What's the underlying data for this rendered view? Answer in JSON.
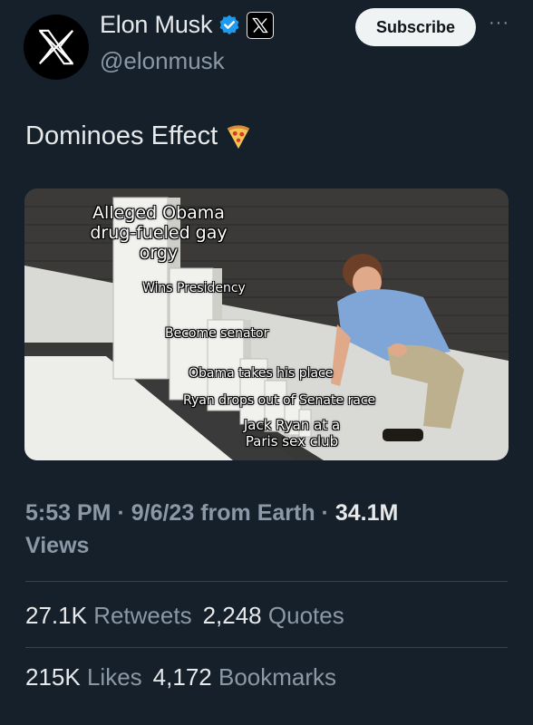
{
  "author": {
    "display_name": "Elon Musk",
    "handle": "@elonmusk",
    "verified_color": "#1d9bf0"
  },
  "header": {
    "subscribe_label": "Subscribe",
    "more_label": "···"
  },
  "tweet": {
    "text": "Dominoes Effect",
    "emoji": "pizza"
  },
  "media": {
    "labels": [
      "Alleged Obama drug-fueled gay orgy",
      "Wins Presidency",
      "Become senator",
      "Obama takes his place",
      "Ryan drops out of Senate race",
      "Jack Ryan at a Paris sex club"
    ]
  },
  "meta": {
    "time": "5:53 PM",
    "date": "9/6/23",
    "source": "from Earth",
    "views_count": "34.1M",
    "views_label": "Views"
  },
  "stats": {
    "retweets_count": "27.1K",
    "retweets_label": "Retweets",
    "quotes_count": "2,248",
    "quotes_label": "Quotes",
    "likes_count": "215K",
    "likes_label": "Likes",
    "bookmarks_count": "4,172",
    "bookmarks_label": "Bookmarks"
  }
}
